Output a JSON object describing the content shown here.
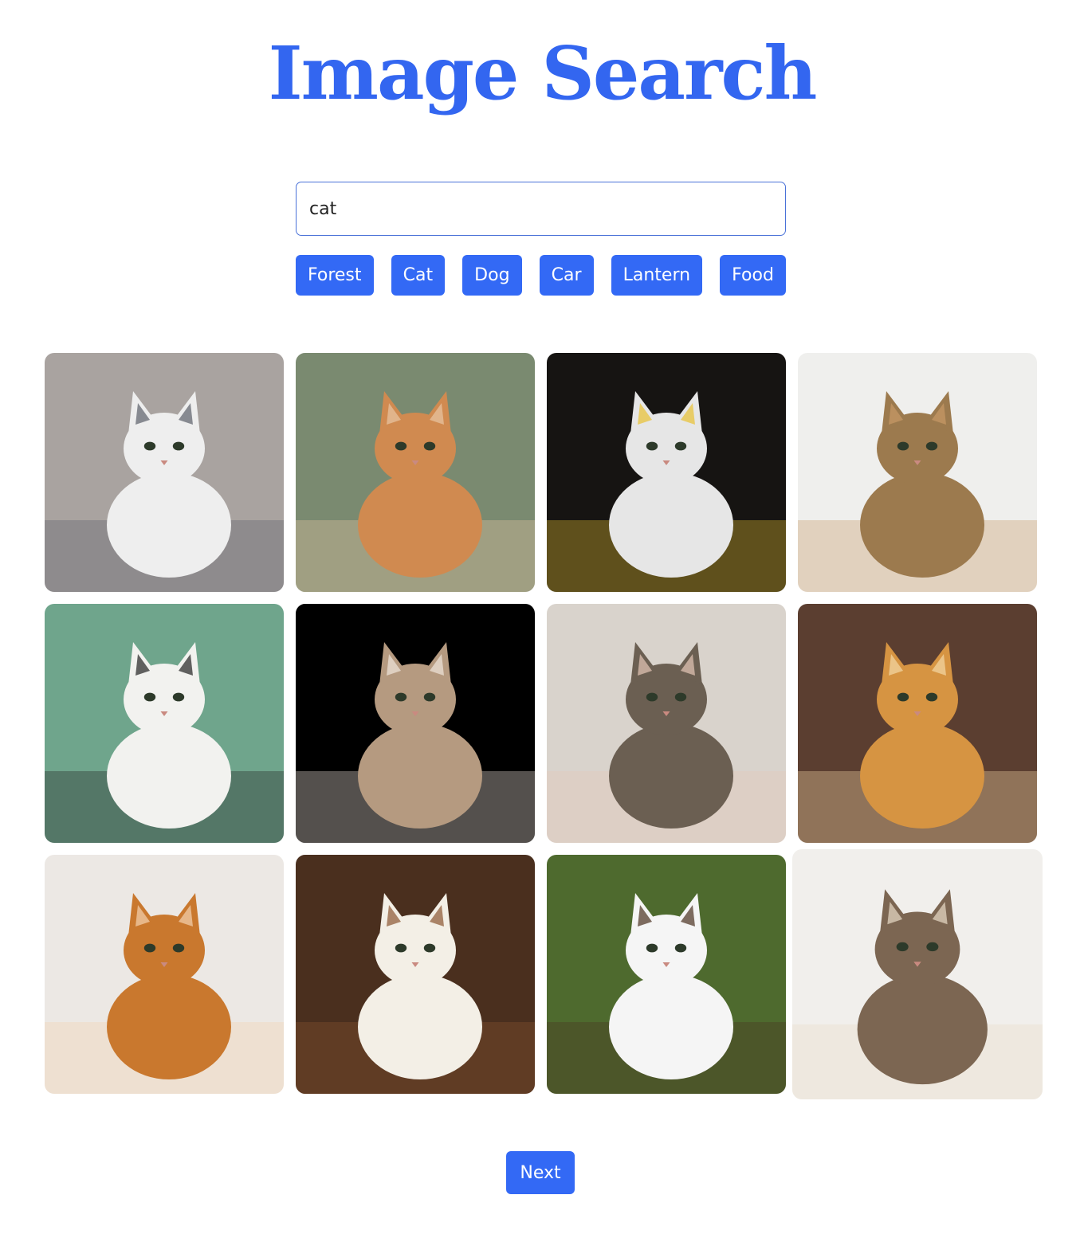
{
  "page": {
    "title": "Image Search"
  },
  "search": {
    "value": "cat"
  },
  "quick_searches": [
    {
      "label": "Forest"
    },
    {
      "label": "Cat"
    },
    {
      "label": "Dog"
    },
    {
      "label": "Car"
    },
    {
      "label": "Lantern"
    },
    {
      "label": "Food"
    }
  ],
  "results": [
    {
      "name": "siamese-cat-blue-eyes",
      "bg": "#a9a3a0",
      "fur": "#eeeeee",
      "accent": "#5b5f6a"
    },
    {
      "name": "orange-cat-sleeping",
      "bg": "#7a8a70",
      "fur": "#d08a50",
      "accent": "#e8c6a4"
    },
    {
      "name": "white-kitten-autumn-leaves",
      "bg": "#161412",
      "fur": "#e6e6e6",
      "accent": "#e8c030"
    },
    {
      "name": "bengal-cat-on-table",
      "bg": "#efefed",
      "fur": "#9c7a4e",
      "accent": "#c99a66"
    },
    {
      "name": "black-white-cat-green-wall",
      "bg": "#6fa58c",
      "fur": "#f2f2ef",
      "accent": "#222222"
    },
    {
      "name": "tabby-cat-black-background",
      "bg": "#000000",
      "fur": "#b59a80",
      "accent": "#f0e6dc"
    },
    {
      "name": "tabby-cat-cuddled",
      "bg": "#d9d3cc",
      "fur": "#6b5f52",
      "accent": "#e6c8b8"
    },
    {
      "name": "maine-coon-orange",
      "bg": "#5b3e30",
      "fur": "#d69442",
      "accent": "#f3d8a6"
    },
    {
      "name": "orange-cat-stretching",
      "bg": "#ece8e4",
      "fur": "#c9782e",
      "accent": "#f3d2b0"
    },
    {
      "name": "calico-cat-petted",
      "bg": "#4a2f1e",
      "fur": "#f3efe6",
      "accent": "#8a5530"
    },
    {
      "name": "calico-cat-grass",
      "bg": "#4e6a2e",
      "fur": "#f5f5f5",
      "accent": "#4a3020"
    },
    {
      "name": "tabby-cat-on-stairs",
      "bg": "#f1efec",
      "fur": "#7c6652",
      "accent": "#e8dcc8"
    }
  ],
  "pagination": {
    "next_label": "Next"
  }
}
